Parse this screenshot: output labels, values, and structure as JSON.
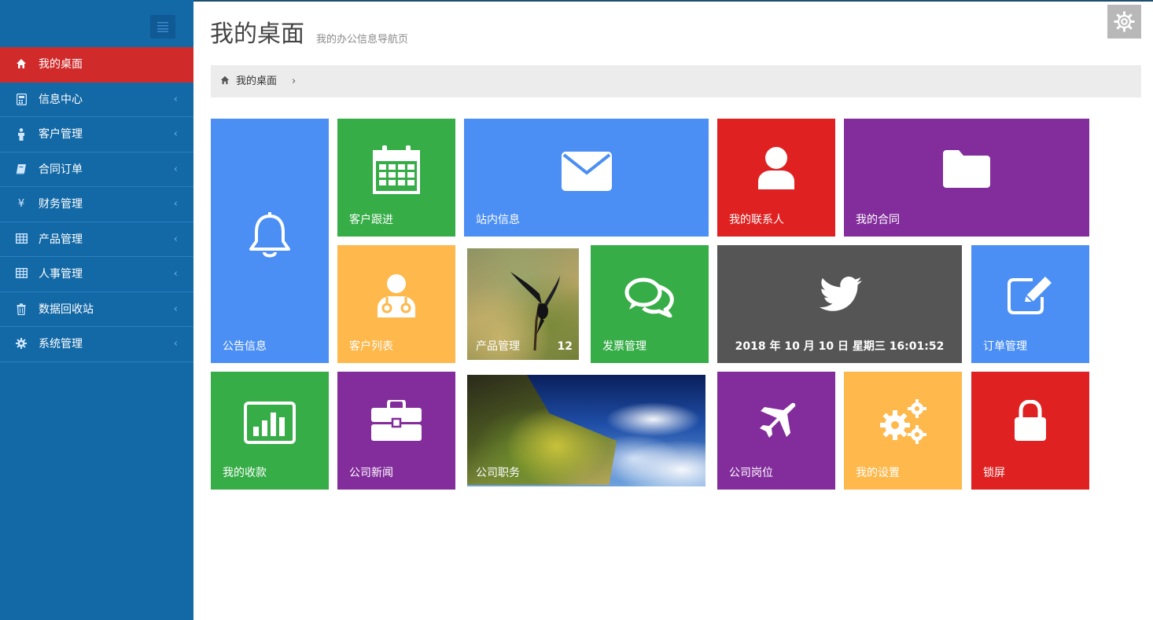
{
  "header": {
    "title": "我的桌面",
    "subtitle": "我的办公信息导航页"
  },
  "breadcrumb": {
    "home_label": "我的桌面",
    "separator": "›"
  },
  "sidebar": {
    "items": [
      {
        "label": "我的桌面",
        "icon": "home-icon",
        "active": true
      },
      {
        "label": "信息中心",
        "icon": "calculator-icon",
        "arrow": "‹"
      },
      {
        "label": "客户管理",
        "icon": "person-icon",
        "arrow": "‹"
      },
      {
        "label": "合同订单",
        "icon": "book-icon",
        "arrow": "‹"
      },
      {
        "label": "财务管理",
        "icon": "yen-icon",
        "glyph": "¥",
        "arrow": "‹"
      },
      {
        "label": "产品管理",
        "icon": "table-icon",
        "arrow": "‹"
      },
      {
        "label": "人事管理",
        "icon": "table-icon",
        "arrow": "‹"
      },
      {
        "label": "数据回收站",
        "icon": "trash-icon",
        "arrow": "‹"
      },
      {
        "label": "系统管理",
        "icon": "gear-icon",
        "arrow": "‹"
      }
    ]
  },
  "tiles": {
    "announcement": {
      "label": "公告信息",
      "icon": "bell-icon"
    },
    "customer_followup": {
      "label": "客户跟进",
      "icon": "calendar-icon"
    },
    "inbox": {
      "label": "站内信息",
      "icon": "envelope-icon"
    },
    "contacts": {
      "label": "我的联系人",
      "icon": "user-icon"
    },
    "contracts": {
      "label": "我的合同",
      "icon": "folder-icon"
    },
    "customer_list": {
      "label": "客户列表",
      "icon": "doctor-icon"
    },
    "product_mgmt": {
      "label": "产品管理",
      "count": "12",
      "image": "bird-photo"
    },
    "invoice_mgmt": {
      "label": "发票管理",
      "icon": "chat-icon"
    },
    "datetime": {
      "text": "2018 年 10 月 10 日 星期三 16:01:52",
      "icon": "twitter-bird-icon"
    },
    "order_mgmt": {
      "label": "订单管理",
      "icon": "edit-icon"
    },
    "payments": {
      "label": "我的收款",
      "icon": "bar-chart-icon"
    },
    "company_news": {
      "label": "公司新闻",
      "icon": "briefcase-icon"
    },
    "company_duties": {
      "label": "公司职务",
      "image": "cliff-sky-photo"
    },
    "company_posts": {
      "label": "公司岗位",
      "icon": "plane-icon"
    },
    "my_settings": {
      "label": "我的设置",
      "icon": "gears-icon"
    },
    "lock_screen": {
      "label": "锁屏",
      "icon": "lock-icon"
    }
  },
  "colors": {
    "sidebar": "#1369a6",
    "active": "#d12a2a",
    "blue": "#4b8ff5",
    "green": "#36ad47",
    "red": "#e02121",
    "purple": "#832c9c",
    "orange": "#feb84b",
    "gray": "#555555"
  }
}
